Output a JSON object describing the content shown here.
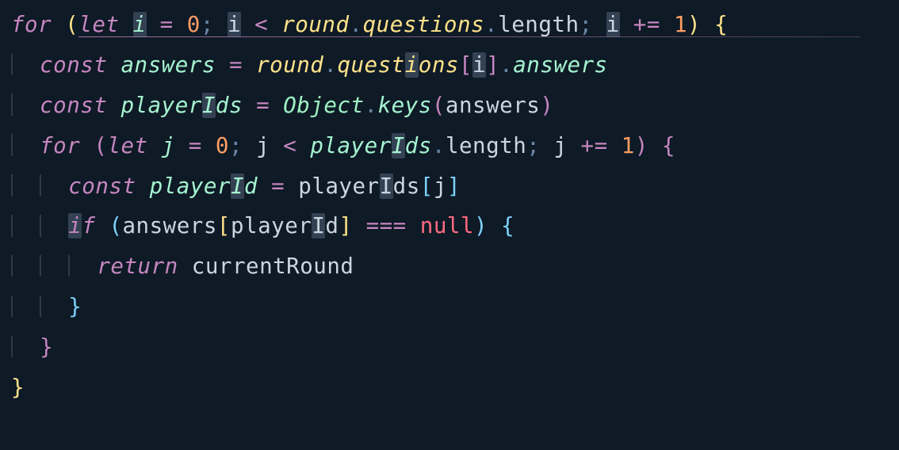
{
  "code": {
    "lines": [
      {
        "indent": 0,
        "tokens": [
          {
            "t": "for",
            "c": "kw"
          },
          {
            "t": " "
          },
          {
            "t": "(",
            "c": "brk1"
          },
          {
            "t": "let",
            "c": "kw"
          },
          {
            "t": " "
          },
          {
            "t": "i",
            "c": "var",
            "hl": true
          },
          {
            "t": " "
          },
          {
            "t": "=",
            "c": "op"
          },
          {
            "t": " "
          },
          {
            "t": "0",
            "c": "num"
          },
          {
            "t": ";",
            "c": "pnc"
          },
          {
            "t": " "
          },
          {
            "t": "i",
            "c": "ident",
            "hl": true
          },
          {
            "t": " "
          },
          {
            "t": "<",
            "c": "op"
          },
          {
            "t": " "
          },
          {
            "t": "round",
            "c": "varY"
          },
          {
            "t": ".",
            "c": "dot"
          },
          {
            "t": "questions",
            "c": "varY"
          },
          {
            "t": ".",
            "c": "dot"
          },
          {
            "t": "length",
            "c": "ident"
          },
          {
            "t": ";",
            "c": "pnc"
          },
          {
            "t": " "
          },
          {
            "t": "i",
            "c": "ident",
            "hl": true
          },
          {
            "t": " "
          },
          {
            "t": "+=",
            "c": "op"
          },
          {
            "t": " "
          },
          {
            "t": "1",
            "c": "num"
          },
          {
            "t": ")",
            "c": "brk1"
          },
          {
            "t": " "
          },
          {
            "t": "{",
            "c": "brk1"
          }
        ]
      },
      {
        "indent": 1,
        "tokens": [
          {
            "t": "const",
            "c": "kw"
          },
          {
            "t": " "
          },
          {
            "t": "answers",
            "c": "var"
          },
          {
            "t": " "
          },
          {
            "t": "=",
            "c": "op"
          },
          {
            "t": " "
          },
          {
            "t": "round",
            "c": "varY"
          },
          {
            "t": ".",
            "c": "dot"
          },
          {
            "t": "quest",
            "c": "varY"
          },
          {
            "t": "i",
            "c": "varY",
            "hl": true
          },
          {
            "t": "ons",
            "c": "varY"
          },
          {
            "t": "[",
            "c": "brk2"
          },
          {
            "t": "i",
            "c": "ident",
            "hl": true
          },
          {
            "t": "]",
            "c": "brk2"
          },
          {
            "t": ".",
            "c": "dot"
          },
          {
            "t": "answers",
            "c": "prop"
          }
        ]
      },
      {
        "indent": 1,
        "tokens": [
          {
            "t": "const",
            "c": "kw"
          },
          {
            "t": " "
          },
          {
            "t": "player",
            "c": "var"
          },
          {
            "t": "I",
            "c": "var",
            "hl": true
          },
          {
            "t": "ds",
            "c": "var"
          },
          {
            "t": " "
          },
          {
            "t": "=",
            "c": "op"
          },
          {
            "t": " "
          },
          {
            "t": "Object",
            "c": "obj"
          },
          {
            "t": ".",
            "c": "dot"
          },
          {
            "t": "keys",
            "c": "prop"
          },
          {
            "t": "(",
            "c": "brk2"
          },
          {
            "t": "answers",
            "c": "ident"
          },
          {
            "t": ")",
            "c": "brk2"
          }
        ]
      },
      {
        "indent": 1,
        "tokens": [
          {
            "t": "for",
            "c": "kw"
          },
          {
            "t": " "
          },
          {
            "t": "(",
            "c": "brk2"
          },
          {
            "t": "let",
            "c": "kw"
          },
          {
            "t": " "
          },
          {
            "t": "j",
            "c": "var"
          },
          {
            "t": " "
          },
          {
            "t": "=",
            "c": "op"
          },
          {
            "t": " "
          },
          {
            "t": "0",
            "c": "num"
          },
          {
            "t": ";",
            "c": "pnc"
          },
          {
            "t": " "
          },
          {
            "t": "j",
            "c": "ident"
          },
          {
            "t": " "
          },
          {
            "t": "<",
            "c": "op"
          },
          {
            "t": " "
          },
          {
            "t": "player",
            "c": "var"
          },
          {
            "t": "I",
            "c": "var",
            "hl": true
          },
          {
            "t": "ds",
            "c": "var"
          },
          {
            "t": ".",
            "c": "dot"
          },
          {
            "t": "length",
            "c": "ident"
          },
          {
            "t": ";",
            "c": "pnc"
          },
          {
            "t": " "
          },
          {
            "t": "j",
            "c": "ident"
          },
          {
            "t": " "
          },
          {
            "t": "+=",
            "c": "op"
          },
          {
            "t": " "
          },
          {
            "t": "1",
            "c": "num"
          },
          {
            "t": ")",
            "c": "brk2"
          },
          {
            "t": " "
          },
          {
            "t": "{",
            "c": "brk2"
          }
        ]
      },
      {
        "indent": 2,
        "tokens": [
          {
            "t": "const",
            "c": "kw"
          },
          {
            "t": " "
          },
          {
            "t": "player",
            "c": "var"
          },
          {
            "t": "I",
            "c": "var",
            "hl": true
          },
          {
            "t": "d",
            "c": "var"
          },
          {
            "t": " "
          },
          {
            "t": "=",
            "c": "op"
          },
          {
            "t": " "
          },
          {
            "t": "player",
            "c": "ident"
          },
          {
            "t": "I",
            "c": "ident",
            "hl": true
          },
          {
            "t": "ds",
            "c": "ident"
          },
          {
            "t": "[",
            "c": "brk3"
          },
          {
            "t": "j",
            "c": "ident"
          },
          {
            "t": "]",
            "c": "brk3"
          }
        ]
      },
      {
        "indent": 2,
        "tokens": [
          {
            "t": "i",
            "c": "kw",
            "hl": true
          },
          {
            "t": "f",
            "c": "kw"
          },
          {
            "t": " "
          },
          {
            "t": "(",
            "c": "brk3"
          },
          {
            "t": "answers",
            "c": "ident"
          },
          {
            "t": "[",
            "c": "brk4"
          },
          {
            "t": "player",
            "c": "ident"
          },
          {
            "t": "I",
            "c": "ident",
            "hl": true
          },
          {
            "t": "d",
            "c": "ident"
          },
          {
            "t": "]",
            "c": "brk4"
          },
          {
            "t": " "
          },
          {
            "t": "===",
            "c": "op"
          },
          {
            "t": " "
          },
          {
            "t": "null",
            "c": "null"
          },
          {
            "t": ")",
            "c": "brk3"
          },
          {
            "t": " "
          },
          {
            "t": "{",
            "c": "brk3"
          }
        ]
      },
      {
        "indent": 3,
        "tokens": [
          {
            "t": "return",
            "c": "kw"
          },
          {
            "t": " "
          },
          {
            "t": "currentRound",
            "c": "ident"
          }
        ]
      },
      {
        "indent": 2,
        "tokens": [
          {
            "t": "}",
            "c": "brk3"
          }
        ]
      },
      {
        "indent": 1,
        "tokens": [
          {
            "t": "}",
            "c": "brk2"
          }
        ]
      },
      {
        "indent": 0,
        "tokens": [
          {
            "t": "}",
            "c": "brk1"
          }
        ]
      }
    ]
  }
}
